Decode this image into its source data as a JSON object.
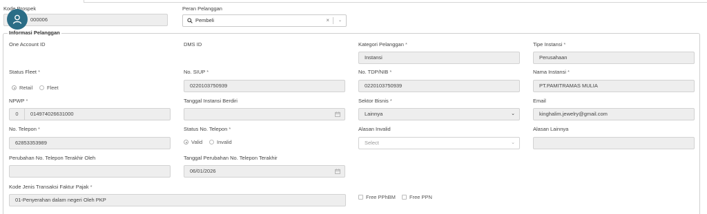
{
  "header": {
    "kode_prospek_label": "Kode Prospek",
    "kode_prospek_value": "000006",
    "peran_pelanggan_label": "Peran Pelanggan",
    "peran_pelanggan_value": "Pembeli",
    "clear_symbol": "×",
    "chevron_symbol": "⌄"
  },
  "section": {
    "title": "Informasi Pelanggan"
  },
  "fields": {
    "one_account_id": {
      "label": "One Account ID"
    },
    "dms_id": {
      "label": "DMS ID"
    },
    "kategori_pelanggan": {
      "label": "Kategori Pelanggan",
      "value": "Instansi"
    },
    "tipe_instansi": {
      "label": "Tipe Instansi",
      "value": "Perusahaan"
    },
    "status_fleet": {
      "label": "Status Fleet",
      "options": [
        "Retail",
        "Fleet"
      ],
      "selected": "Retail"
    },
    "no_siup": {
      "label": "No. SIUP",
      "value": "0220103750939"
    },
    "no_tdp_nib": {
      "label": "No. TDP/NIB",
      "value": "0220103750939"
    },
    "nama_instansi": {
      "label": "Nama Instansi",
      "value": "PT.PAMITRAMAS MULIA"
    },
    "npwp": {
      "label": "NPWP",
      "prefix": "0",
      "value": "014974026631000"
    },
    "tanggal_instansi_berdiri": {
      "label": "Tanggal Instansi Berdiri",
      "value": ""
    },
    "sektor_bisnis": {
      "label": "Sektor Bisnis",
      "value": "Lainnya",
      "chevron": "⌄"
    },
    "email": {
      "label": "Email",
      "value": "kinghalim.jewelry@gmail.com"
    },
    "no_telepon": {
      "label": "No. Telepon",
      "value": "62853353989"
    },
    "status_no_telepon": {
      "label": "Status No. Telepon",
      "options": [
        "Valid",
        "Invalid"
      ],
      "selected": "Valid"
    },
    "alasan_invalid": {
      "label": "Alasan Invalid",
      "placeholder": "Select",
      "chevron": "⌄"
    },
    "alasan_lainnya": {
      "label": "Alasan Lainnya",
      "value": ""
    },
    "perubahan_telepon_oleh": {
      "label": "Perubahan No. Telepon Terakhir Oleh",
      "value": ""
    },
    "tanggal_perubahan_telepon": {
      "label": "Tanggal Perubahan No. Telepon Terakhir",
      "value": "06/01/2026"
    },
    "kode_jenis_transaksi": {
      "label": "Kode Jenis Transaksi Faktur Pajak",
      "value": "01-Penyerahan dalam negeri Oleh PKP"
    },
    "free_pphbm": {
      "label": "Free PPhBM",
      "checked": false
    },
    "free_ppn": {
      "label": "Free PPN",
      "checked": false
    }
  },
  "required_marker": "*",
  "icons": [
    "user-icon",
    "search-icon",
    "calendar-icon",
    "chevron-down-icon"
  ]
}
